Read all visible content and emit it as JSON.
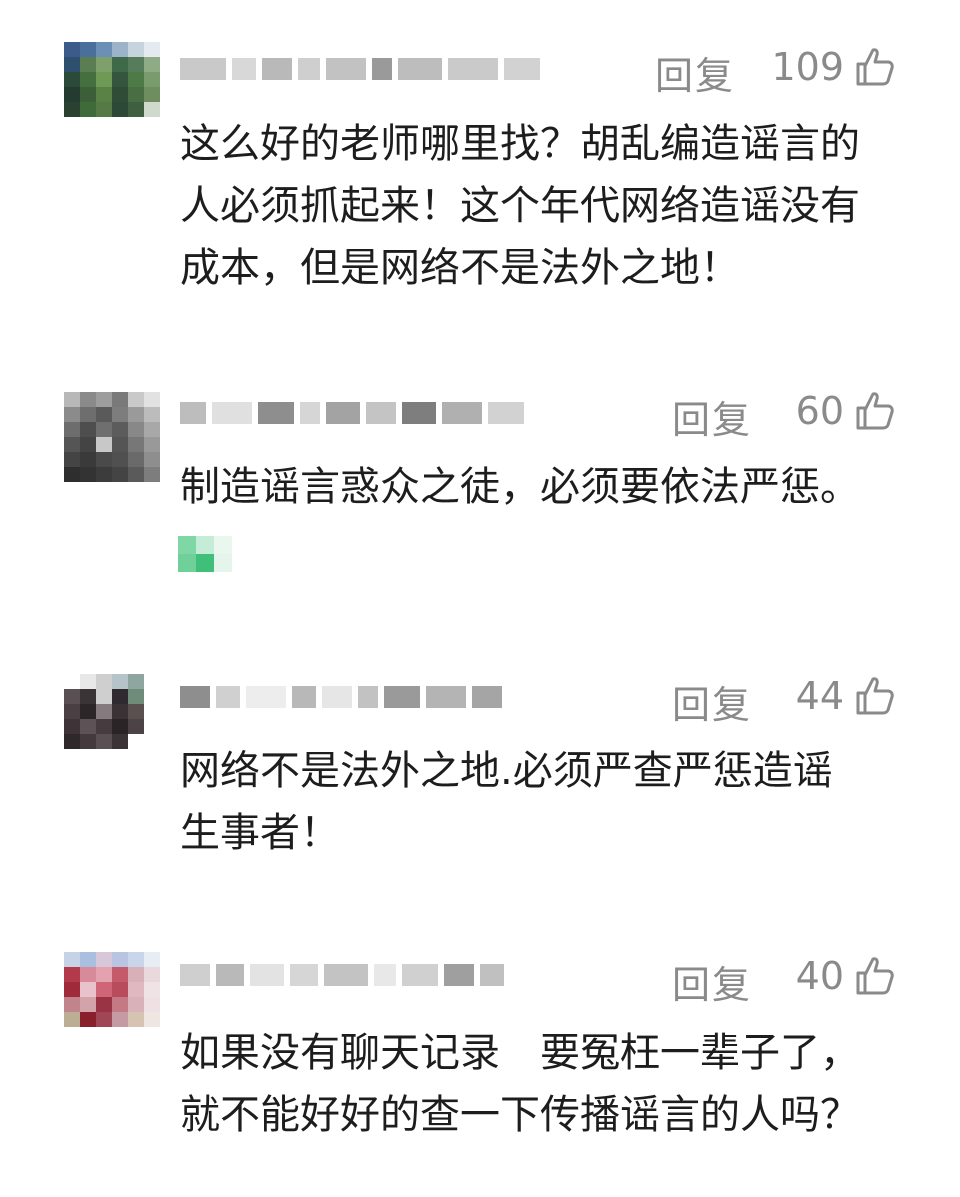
{
  "comments": [
    {
      "reply_label": "回复",
      "likes": "109",
      "text_lines": [
        "这么好的老师哪里找？胡乱编造谣言的",
        "人必须抓起来！这个年代网络造谣没有",
        "成本，但是网络不是法外之地！"
      ]
    },
    {
      "reply_label": "回复",
      "likes": "60",
      "text_lines": [
        "制造谣言惑众之徒，必须要依法严惩。"
      ]
    },
    {
      "reply_label": "回复",
      "likes": "44",
      "text_lines": [
        "网络不是法外之地.必须严查严惩造谣",
        "生事者！"
      ]
    },
    {
      "reply_label": "回复",
      "likes": "40",
      "text_lines": [
        "如果没有聊天记录　要冤枉一辈子了，",
        "就不能好好的查一下传播谣言的人吗？"
      ]
    }
  ],
  "colors": {
    "text": "#1d1d1d",
    "meta": "#8a8a8a",
    "background": "#ffffff"
  },
  "icons": {
    "like": "thumbs-up-icon",
    "avatar": "pixelated-avatar",
    "username": "pixelated-username"
  }
}
